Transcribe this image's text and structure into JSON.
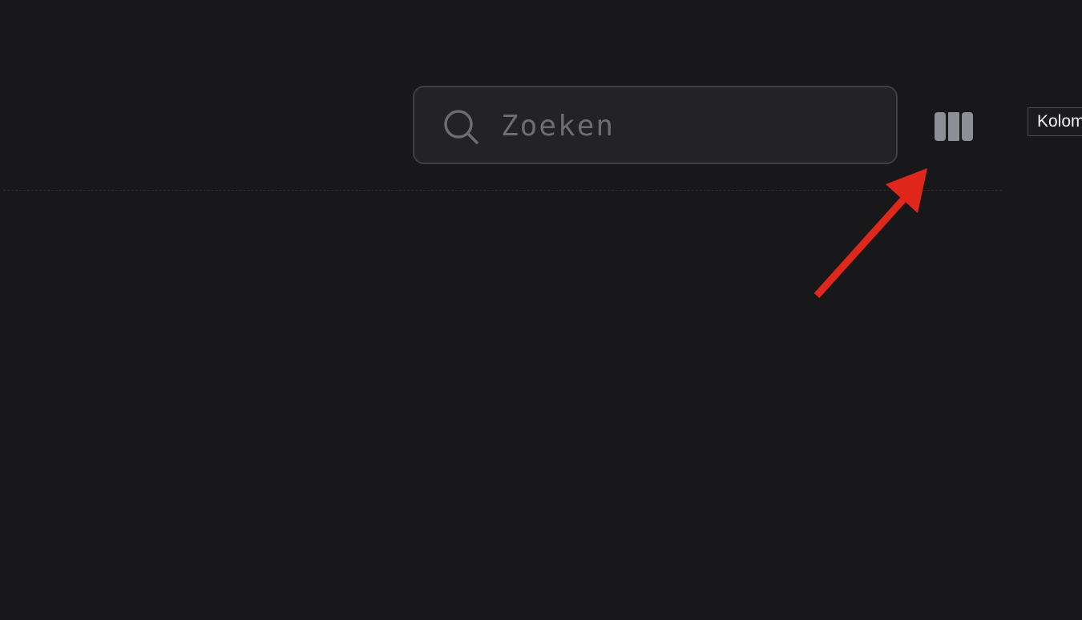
{
  "search": {
    "placeholder": "Zoeken",
    "value": "",
    "icon": "search-icon"
  },
  "toolbar": {
    "columns_icon": "columns-icon",
    "tooltip_text": "Kolom"
  },
  "annotation": {
    "icon": "arrow-icon",
    "color": "#e0271c"
  },
  "colors": {
    "background": "#18181a",
    "input_background": "#232326",
    "input_border": "#3f3f44",
    "icon": "#8e8e96"
  }
}
